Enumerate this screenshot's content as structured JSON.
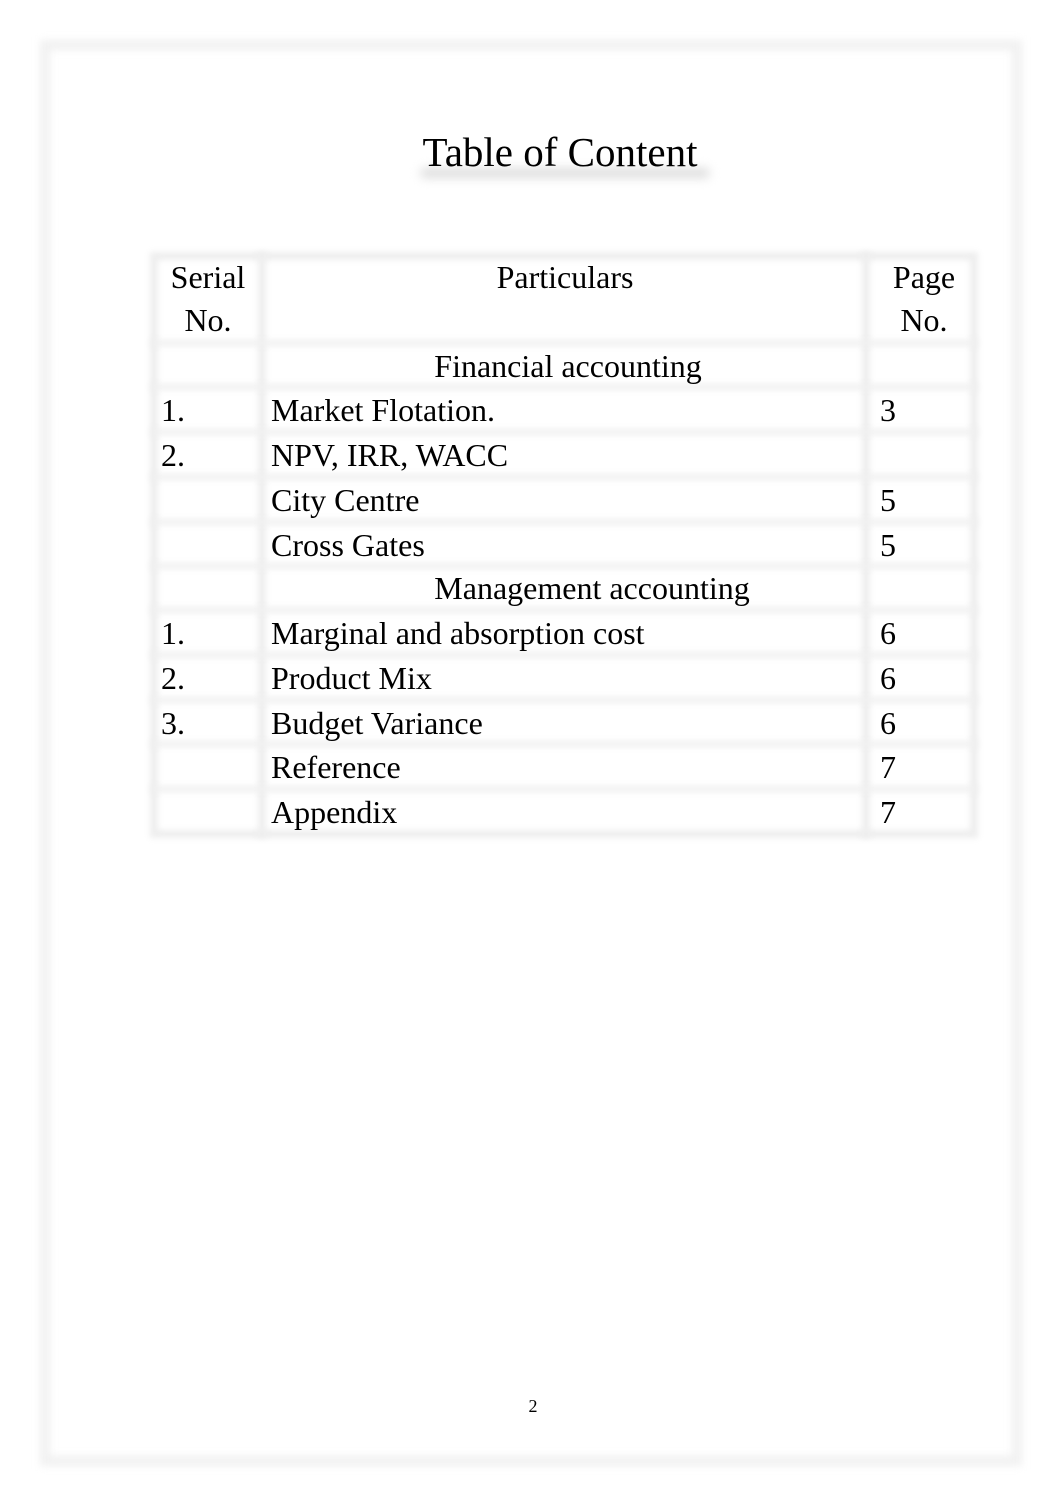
{
  "document": {
    "title": "Table of Content",
    "page_number": "2"
  },
  "table": {
    "headers": {
      "serial": "Serial No.",
      "particulars": "Particulars",
      "page": "Page No."
    },
    "rows": [
      {
        "type": "section",
        "serial": "",
        "particulars": "Financial accounting",
        "page": ""
      },
      {
        "type": "item",
        "serial": "1.",
        "particulars": "Market Flotation.",
        "page": "3"
      },
      {
        "type": "item",
        "serial": "2.",
        "particulars": "NPV, IRR, WACC",
        "page": ""
      },
      {
        "type": "item",
        "serial": "",
        "particulars": "City Centre",
        "page": "5"
      },
      {
        "type": "item",
        "serial": "",
        "particulars": "Cross Gates",
        "page": "5"
      },
      {
        "type": "section",
        "serial": "",
        "particulars": "Management accounting",
        "page": ""
      },
      {
        "type": "item",
        "serial": "1.",
        "particulars": "Marginal and absorption cost",
        "page": "6"
      },
      {
        "type": "item",
        "serial": "2.",
        "particulars": "Product Mix",
        "page": "6"
      },
      {
        "type": "item",
        "serial": "3.",
        "particulars": "Budget Variance",
        "page": "6"
      },
      {
        "type": "item",
        "serial": "",
        "particulars": "Reference",
        "page": "7"
      },
      {
        "type": "item",
        "serial": "",
        "particulars": "Appendix",
        "page": "7"
      }
    ]
  }
}
